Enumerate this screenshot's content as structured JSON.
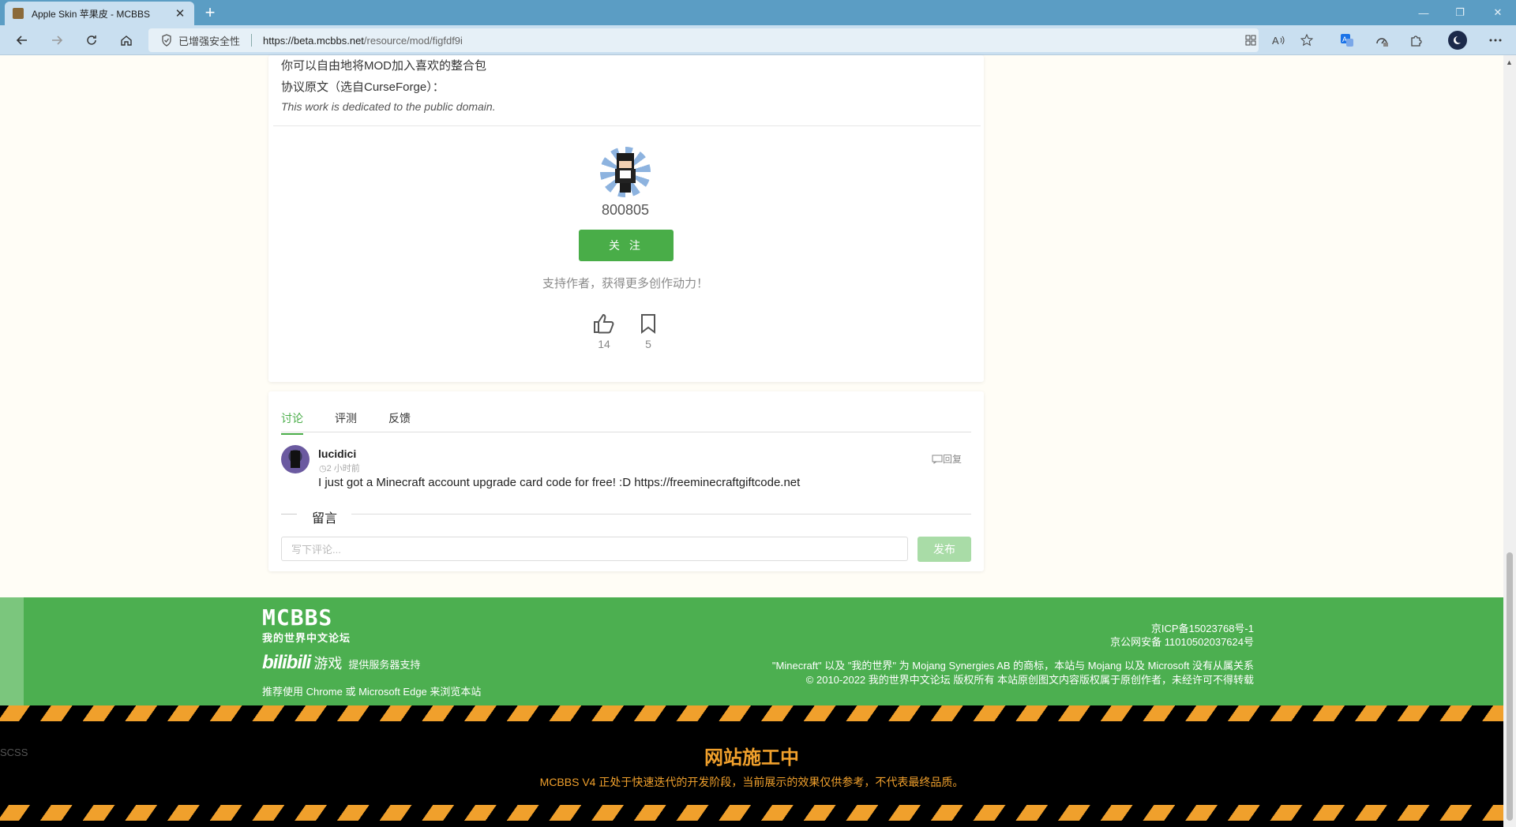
{
  "browser": {
    "tab_title": "Apple Skin 苹果皮 - MCBBS",
    "tab_close": "✕",
    "new_tab": "+",
    "security_label": "已增强安全性",
    "url_host": "https://beta.mcbbs.net",
    "url_path": "/resource/mod/figfdf9i",
    "win_min": "—",
    "win_max": "❐",
    "win_close": "✕",
    "icons": [
      "back-icon",
      "forward-icon",
      "refresh-icon",
      "home-icon",
      "apps-icon",
      "read-aloud-icon",
      "favorites-icon",
      "translate-icon",
      "performance-icon",
      "extensions-icon",
      "profile-icon",
      "more-icon"
    ]
  },
  "license": {
    "line1": "你可以自由地将MOD加入喜欢的整合包",
    "line2": "协议原文（选自CurseForge）：",
    "line3": "This work is dedicated to the public domain."
  },
  "author": {
    "name": "800805",
    "follow_label": "关 注",
    "support_text": "支持作者，获得更多创作动力！",
    "likes": "14",
    "bookmarks": "5"
  },
  "discussion": {
    "tabs": [
      "讨论",
      "评测",
      "反馈"
    ],
    "active_tab": 0,
    "comment": {
      "user": "lucidici",
      "time": "2 小时前",
      "text": "I just got a Minecraft account upgrade card code for free! :D https://freeminecraftgiftcode.net",
      "reply_label": "回复"
    },
    "message_title": "留言",
    "input_placeholder": "写下评论...",
    "publish_label": "发布"
  },
  "footer": {
    "logo_main": "MCBBS",
    "logo_sub": "我的世界中文论坛",
    "bili_logo": "bilibili",
    "bili_game": "游戏",
    "bili_support": "提供服务器支持",
    "recommend": "推荐使用 Chrome 或 Microsoft Edge 来浏览本站",
    "icp": "京ICP备15023768号-1",
    "police": "京公网安备 11010502037624号",
    "trademark": "\"Minecraft\" 以及 \"我的世界\" 为 Mojang Synergies AB 的商标，本站与 Mojang 以及 Microsoft 没有从属关系",
    "copyright": "© 2010-2022 我的世界中文论坛 版权所有 本站原创图文内容版权属于原创作者，未经许可不得转载"
  },
  "banner": {
    "title": "网站施工中",
    "subtitle": "MCBBS V4 正处于快速迭代的开发阶段，当前展示的效果仅供参考，不代表最终品质。",
    "scss_label": "SCSS"
  },
  "colors": {
    "accent_green": "#49ad48",
    "footer_green": "#4caf50",
    "warning_orange": "#f0a02c"
  }
}
